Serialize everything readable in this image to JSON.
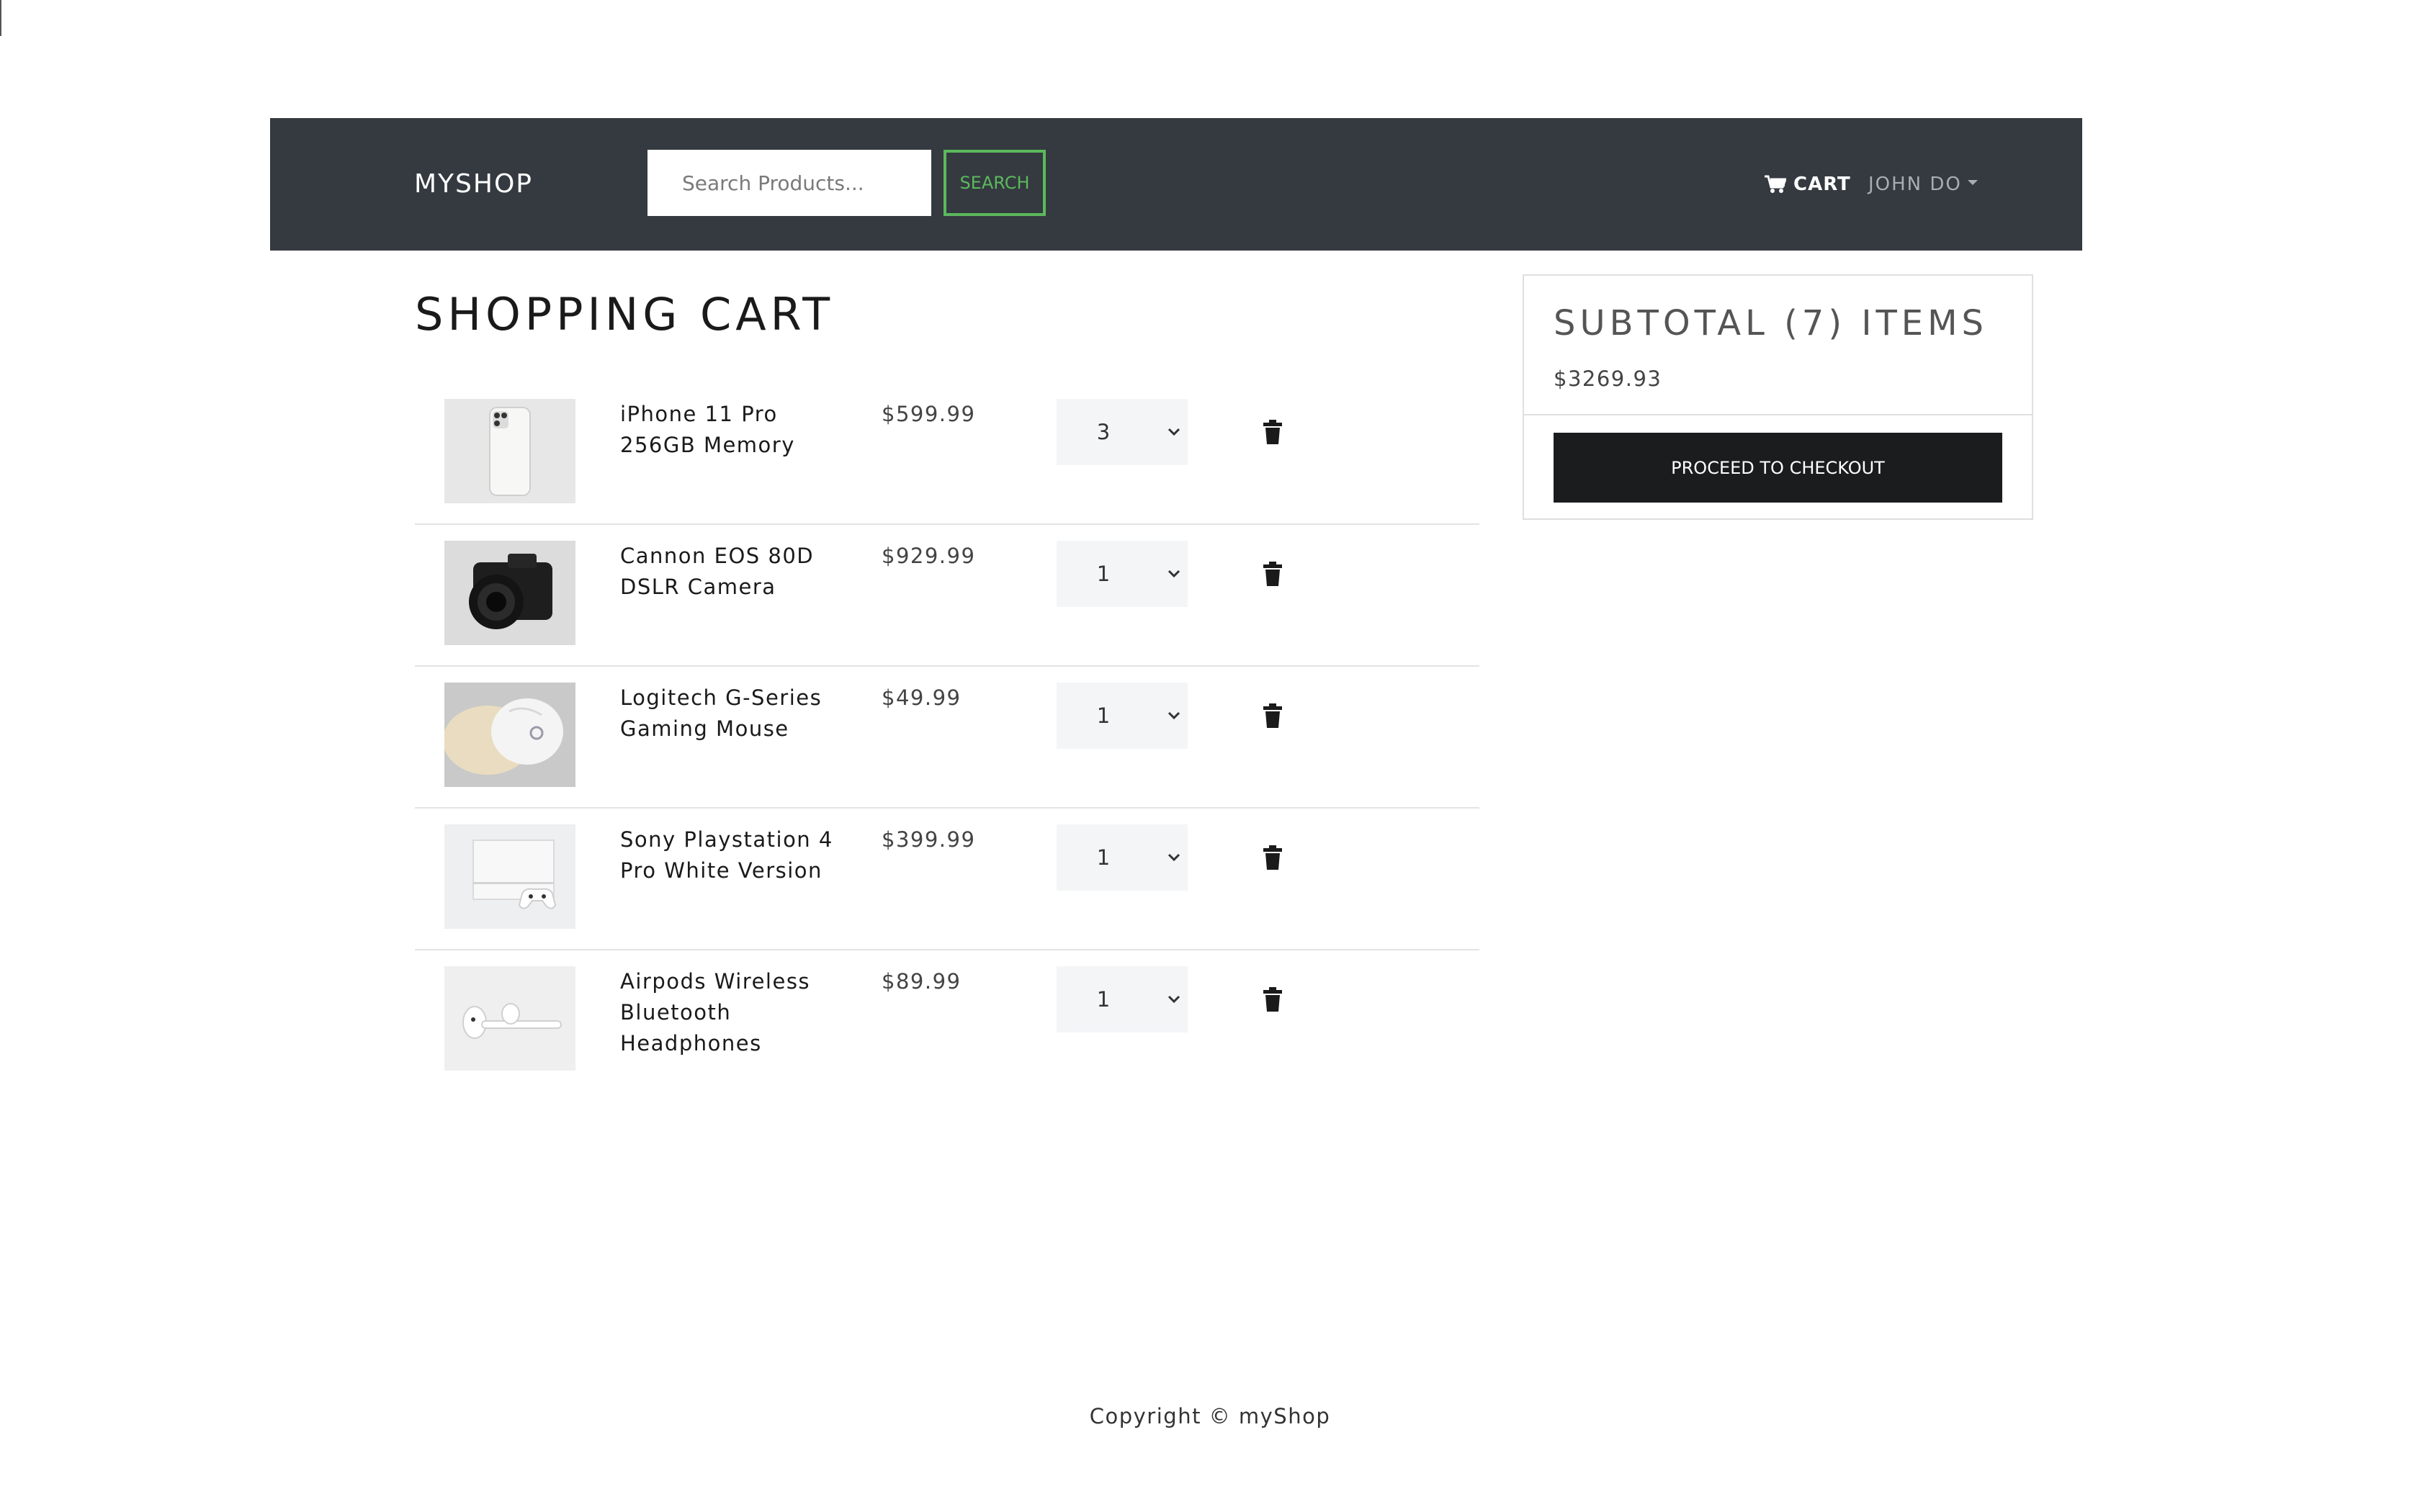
{
  "navbar": {
    "brand": "MYSHOP",
    "search_placeholder": "Search Products...",
    "search_button": "SEARCH",
    "cart_label": "CART",
    "user_label": "JOHN DO"
  },
  "cart": {
    "title": "SHOPPING CART",
    "items": [
      {
        "name": "iPhone 11 Pro 256GB Memory",
        "price": "$599.99",
        "qty": "3",
        "image": "iphone"
      },
      {
        "name": "Cannon EOS 80D DSLR Camera",
        "price": "$929.99",
        "qty": "1",
        "image": "camera"
      },
      {
        "name": "Logitech G-Series Gaming Mouse",
        "price": "$49.99",
        "qty": "1",
        "image": "mouse"
      },
      {
        "name": "Sony Playstation 4 Pro White Version",
        "price": "$399.99",
        "qty": "1",
        "image": "playstation"
      },
      {
        "name": "Airpods Wireless Bluetooth Headphones",
        "price": "$89.99",
        "qty": "1",
        "image": "airpods"
      }
    ]
  },
  "summary": {
    "title": "SUBTOTAL (7) ITEMS",
    "total": "$3269.93",
    "checkout_button": "PROCEED TO CHECKOUT"
  },
  "footer": {
    "text": "Copyright © myShop"
  },
  "colors": {
    "navbar_bg": "#343a40",
    "search_accent": "#5cb85c",
    "checkout_bg": "#1b1c1d"
  }
}
